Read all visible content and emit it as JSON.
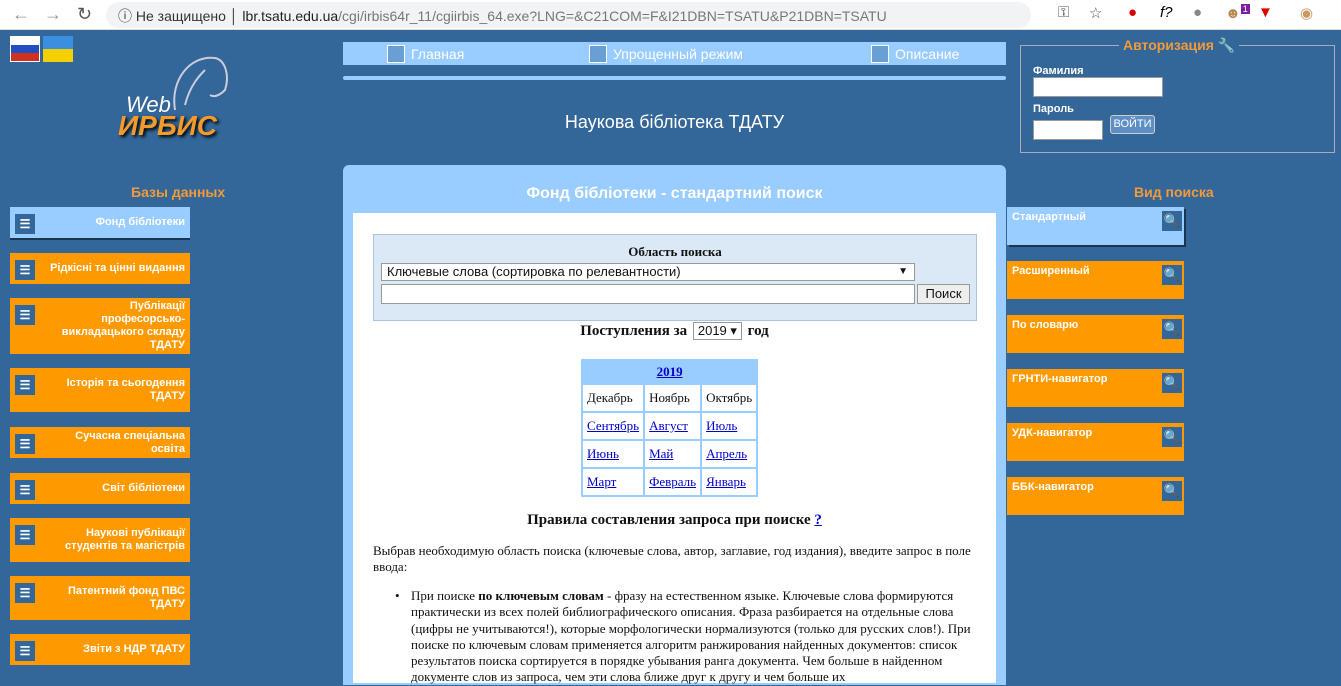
{
  "browser": {
    "security": "Не защищено",
    "host": "lbr.tsatu.edu.ua",
    "path": "/cgi/irbis64r_11/cgiirbis_64.exe?LNG=&C21COM=F&I21DBN=TSATU&P21DBN=TSATU",
    "ext_badge": "1"
  },
  "logo": {
    "web": "Web",
    "irbis": "ИРБИС"
  },
  "topnav": [
    {
      "label": "Главная"
    },
    {
      "label": "Упрощенный режим"
    },
    {
      "label": "Описание"
    }
  ],
  "site_title": "Наукова бібліотека ТДАТУ",
  "auth": {
    "title": "Авторизация",
    "surname_label": "Фамилия",
    "password_label": "Пароль",
    "login_button": "ВОЙТИ"
  },
  "databases": {
    "heading": "Базы данных",
    "items": [
      {
        "label": "Фонд бібліотеки"
      },
      {
        "label": "Рідкісні та цінні видання"
      },
      {
        "label": "Публікації професорсько-викладацького складу ТДАТУ"
      },
      {
        "label": "Історія та сьогодення ТДАТУ"
      },
      {
        "label": "Сучасна спеціальна освіта"
      },
      {
        "label": "Світ бібліотеки"
      },
      {
        "label": "Наукові публікації студентів та магістрів"
      },
      {
        "label": "Патентний фонд ПВС ТДАТУ"
      },
      {
        "label": "Звіти з НДР ТДАТУ"
      }
    ]
  },
  "search_types": {
    "heading": "Вид поиска",
    "items": [
      {
        "label": "Стандартный"
      },
      {
        "label": "Расширенный"
      },
      {
        "label": "По словарю"
      },
      {
        "label": "ГРНТИ-навигатор"
      },
      {
        "label": "УДК-навигатор"
      },
      {
        "label": "ББК-навигатор"
      }
    ]
  },
  "panel_title": "Фонд бібліотеки - стандартний поиск",
  "search": {
    "area_label": "Область поиска",
    "area_value": "Ключевые слова (сортировка по релевантности)",
    "query": "",
    "button": "Поиск"
  },
  "arrivals": {
    "prefix": "Поступления за",
    "year": "2019",
    "suffix": "год"
  },
  "calendar": {
    "year": "2019",
    "rows": [
      [
        "Декабрь",
        "Ноябрь",
        "Октябрь"
      ],
      [
        "Сентябрь",
        "Август",
        "Июль"
      ],
      [
        "Июнь",
        "Май",
        "Апрель"
      ],
      [
        "Март",
        "Февраль",
        "Январь"
      ]
    ]
  },
  "rules": {
    "title": "Правила составления запроса при поиске",
    "help": "?",
    "intro": "Выбрав необходимую область поиска (ключевые слова, автор, заглавие, год издания), введите запрос в поле ввода:",
    "bullet_pre": "При поиске ",
    "bullet_bold": "по ключевым словам",
    "bullet_text": " - фразу на естественном языке. Ключевые слова формируются практически из всех полей библиографического описания. Фраза разбирается на отдельные слова (цифры не учитываются!), которые морфологически нормализуются (только для русских слов!). При поиске по ключевым словам применяется алгоритм ранжирования найденных документов: список результатов поиска сортируется в порядке убывания ранга документа. Чем больше в найденном документе слов из запроса, чем эти слова ближе друг к другу и чем больше их"
  }
}
